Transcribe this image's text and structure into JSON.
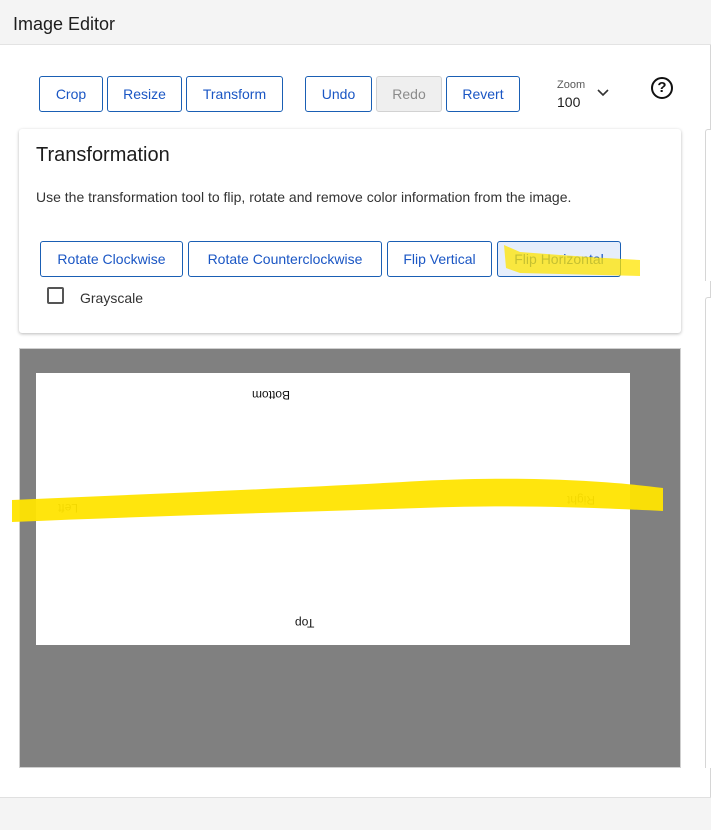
{
  "window": {
    "title": "Image Editor"
  },
  "toolbar": {
    "crop": "Crop",
    "resize": "Resize",
    "transform": "Transform",
    "undo": "Undo",
    "redo": "Redo",
    "revert": "Revert",
    "zoom_label": "Zoom",
    "zoom_value": "100"
  },
  "transformation": {
    "title": "Transformation",
    "description": "Use the transformation tool to flip, rotate and remove color information from the image.",
    "rotate_cw": "Rotate Clockwise",
    "rotate_ccw": "Rotate Counterclockwise",
    "flip_vertical": "Flip Vertical",
    "flip_horizontal": "Flip Horizontal",
    "grayscale": "Grayscale",
    "grayscale_checked": false
  },
  "image": {
    "labels": {
      "top": "Top",
      "bottom": "Bottom",
      "left": "Left",
      "right": "Right"
    }
  },
  "colors": {
    "accent": "#1a56c4",
    "highlight": "#ffe400",
    "canvas_bg": "#808080"
  },
  "icons": {
    "help": "help-icon",
    "zoom_dropdown": "chevron-down-icon"
  }
}
